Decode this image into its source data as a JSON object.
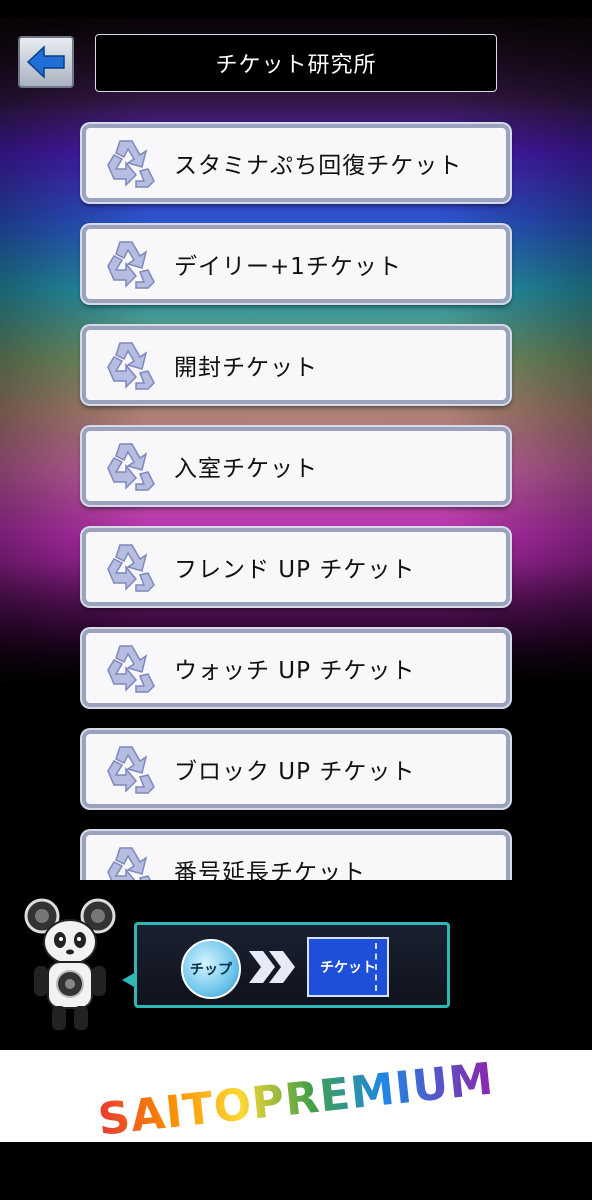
{
  "header": {
    "title": "チケット研究所",
    "back_icon": "arrow-left-icon"
  },
  "tickets": [
    {
      "label": "スタミナぷち回復チケット",
      "icon": "recycle-icon"
    },
    {
      "label": "デイリー+1チケット",
      "icon": "recycle-icon"
    },
    {
      "label": "開封チケット",
      "icon": "recycle-icon"
    },
    {
      "label": "入室チケット",
      "icon": "recycle-icon"
    },
    {
      "label": "フレンド UP チケット",
      "icon": "recycle-icon"
    },
    {
      "label": "ウォッチ UP チケット",
      "icon": "recycle-icon"
    },
    {
      "label": "ブロック UP チケット",
      "icon": "recycle-icon"
    },
    {
      "label": "番号延長チケット",
      "icon": "recycle-icon"
    }
  ],
  "banner": {
    "chip_label": "チップ",
    "ticket_label": "チケット"
  },
  "footer": {
    "brand": "SAITOPREMIUM"
  },
  "colors": {
    "accent": "#2fb7b5",
    "back_arrow": "#1f6fd6",
    "ticket_box": "#1e4fd8"
  }
}
